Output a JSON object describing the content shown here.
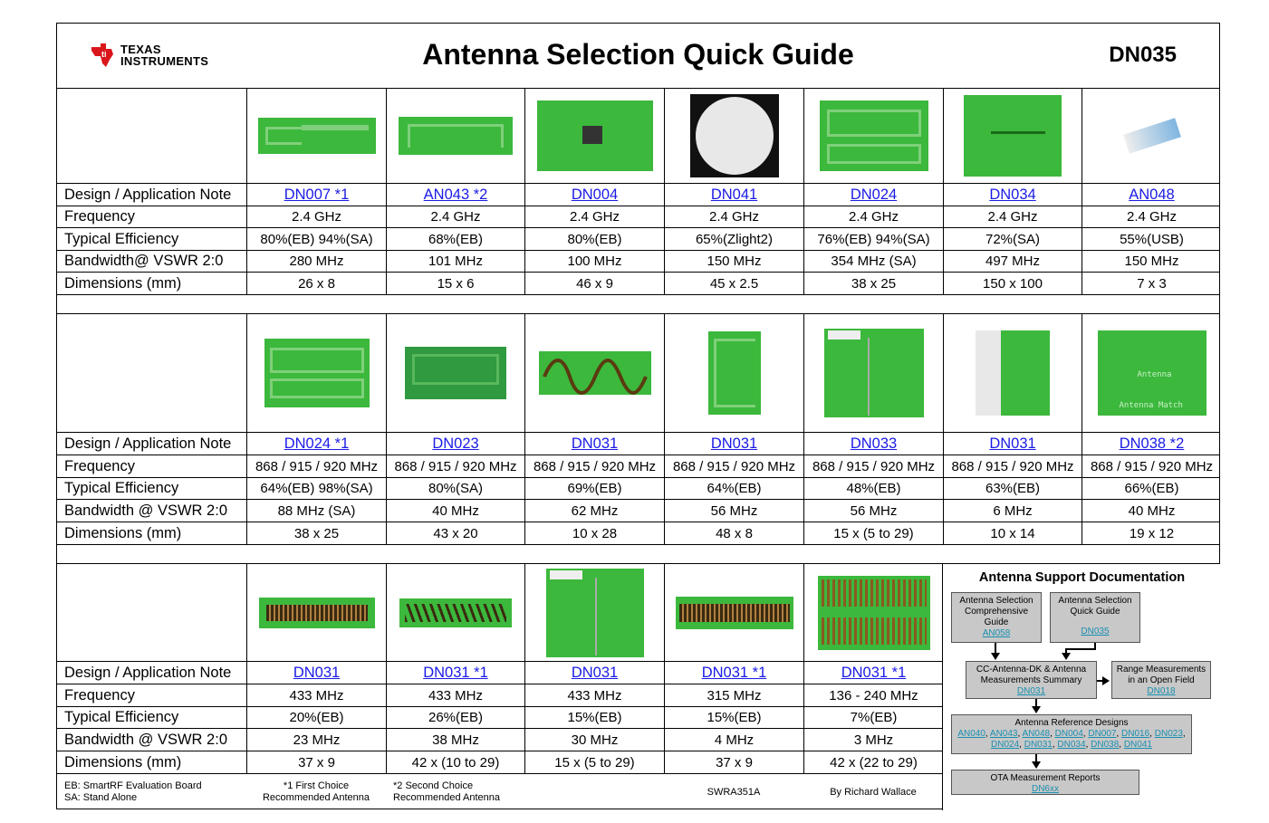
{
  "header": {
    "logo_line1": "Texas",
    "logo_line2": "Instruments",
    "title": "Antenna Selection Quick Guide",
    "doc_number": "DN035"
  },
  "labels": {
    "design": "Design / Application Note",
    "frequency": "Frequency",
    "efficiency": "Typical Efficiency",
    "bandwidth_a": "Bandwidth@ VSWR 2:0",
    "bandwidth_b": "Bandwidth @ VSWR 2:0",
    "dimensions": "Dimensions (mm)"
  },
  "section1": {
    "notes": [
      "DN007 *1",
      "AN043 *2",
      "DN004",
      "DN041",
      "DN024",
      "DN034",
      "AN048"
    ],
    "frequency": [
      "2.4 GHz",
      "2.4 GHz",
      "2.4 GHz",
      "2.4 GHz",
      "2.4 GHz",
      "2.4 GHz",
      "2.4 GHz"
    ],
    "efficiency": [
      "80%(EB) 94%(SA)",
      "68%(EB)",
      "80%(EB)",
      "65%(Zlight2)",
      "76%(EB) 94%(SA)",
      "72%(SA)",
      "55%(USB)"
    ],
    "bandwidth": [
      "280 MHz",
      "101 MHz",
      "100 MHz",
      "150 MHz",
      "354 MHz (SA)",
      "497 MHz",
      "150 MHz"
    ],
    "dimensions": [
      "26 x 8",
      "15 x 6",
      "46 x 9",
      "45 x 2.5",
      "38 x 25",
      "150 x 100",
      "7 x 3"
    ]
  },
  "section2": {
    "notes": [
      "DN024 *1",
      "DN023",
      "DN031",
      "DN031",
      "DN033",
      "DN031",
      "DN038 *2"
    ],
    "frequency": [
      "868 / 915 / 920 MHz",
      "868 / 915 / 920 MHz",
      "868 / 915 / 920 MHz",
      "868 / 915 / 920 MHz",
      "868 / 915 / 920 MHz",
      "868 / 915 / 920 MHz",
      "868 / 915 / 920 MHz"
    ],
    "efficiency": [
      "64%(EB) 98%(SA)",
      "80%(SA)",
      "69%(EB)",
      "64%(EB)",
      "48%(EB)",
      "63%(EB)",
      "66%(EB)"
    ],
    "bandwidth": [
      "88 MHz (SA)",
      "40 MHz",
      "62 MHz",
      "56 MHz",
      "56 MHz",
      "6 MHz",
      "40 MHz"
    ],
    "dimensions": [
      "38 x 25",
      "43 x 20",
      "10 x 28",
      "48 x 8",
      "15 x (5 to 29)",
      "10 x 14",
      "19 x 12"
    ],
    "photo_text": [
      "Antenna",
      "Antenna Match"
    ]
  },
  "section3": {
    "notes": [
      "DN031",
      "DN031 *1",
      "DN031",
      "DN031 *1",
      "DN031 *1"
    ],
    "frequency": [
      "433 MHz",
      "433 MHz",
      "433 MHz",
      "315 MHz",
      "136 - 240 MHz"
    ],
    "efficiency": [
      "20%(EB)",
      "26%(EB)",
      "15%(EB)",
      "15%(EB)",
      "7%(EB)"
    ],
    "bandwidth": [
      "23 MHz",
      "38 MHz",
      "30 MHz",
      "4 MHz",
      "3 MHz"
    ],
    "dimensions": [
      "37 x 9",
      "42 x (10 to 29)",
      "15 x (5 to 29)",
      "37 x 9",
      "42 x (22 to 29)"
    ]
  },
  "footer": {
    "eb": "EB: SmartRF Evaluation Board",
    "sa": "SA: Stand Alone",
    "first1": "*1 First Choice",
    "first2": "Recommended Antenna",
    "second1": "*2 Second Choice",
    "second2": "Recommended Antenna",
    "swra": "SWRA351A",
    "author": "By Richard Wallace"
  },
  "support": {
    "title": "Antenna Support Documentation",
    "comp_l1": "Antenna Selection",
    "comp_l2": "Comprehensive",
    "comp_l3": "Guide",
    "comp_link": "AN058",
    "quick_l1": "Antenna Selection",
    "quick_l2": "Quick Guide",
    "quick_link": "DN035",
    "dk_l1": "CC-Antenna-DK & Antenna",
    "dk_l2": "Measurements Summary",
    "dk_link": "DN031",
    "range_l1": "Range Measurements",
    "range_l2": "in an Open Field",
    "range_link": "DN018",
    "ref_title": "Antenna Reference Designs",
    "ref_links_1": [
      "AN040",
      "AN043",
      "AN048",
      "DN004",
      "DN007",
      "DN016",
      "DN023"
    ],
    "ref_links_2": [
      "DN024",
      "DN031",
      "DN034",
      "DN038",
      "DN041"
    ],
    "ota_l1": "OTA Measurement Reports",
    "ota_link": "DN6xx"
  },
  "colors": {
    "pcb": "#3cb83c",
    "link": "#1a1ae6",
    "box": "#c8c8c8"
  }
}
